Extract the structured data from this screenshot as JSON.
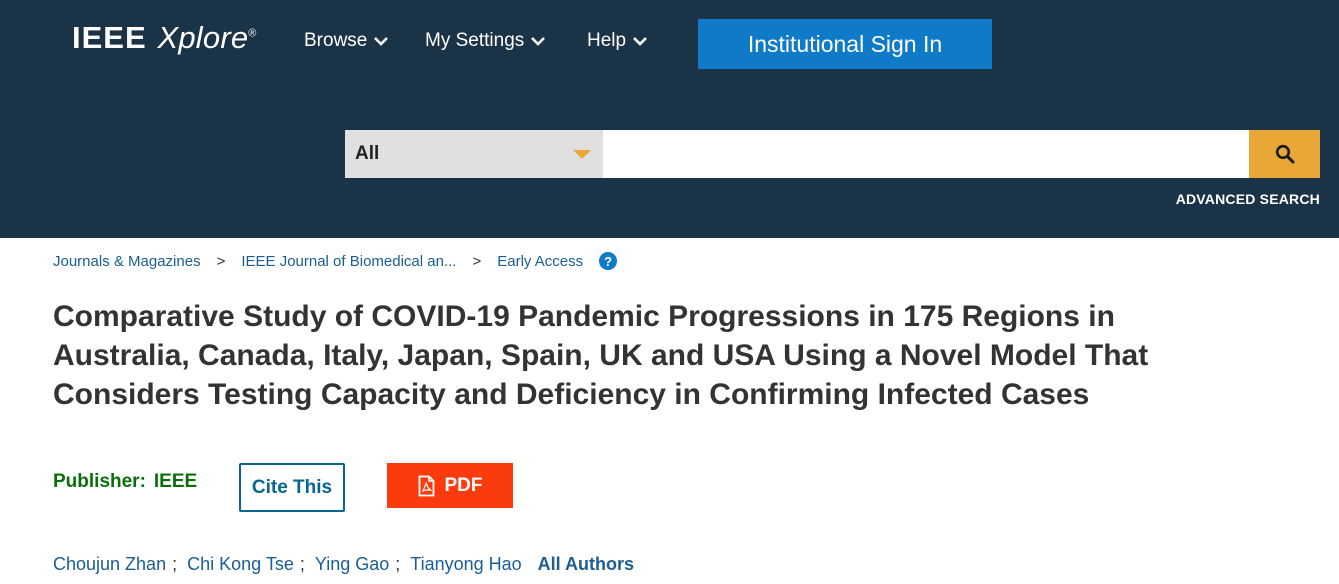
{
  "header": {
    "logo_main": "IEEE",
    "logo_sub": "Xplore",
    "logo_mark": "®",
    "nav": [
      {
        "label": "Browse"
      },
      {
        "label": "My Settings"
      },
      {
        "label": "Help"
      }
    ],
    "signin_label": "Institutional Sign In"
  },
  "search": {
    "scope_value": "All",
    "query_value": "",
    "search_icon": "search-icon",
    "advanced_label": "ADVANCED SEARCH"
  },
  "breadcrumb": {
    "items": [
      "Journals & Magazines",
      "IEEE Journal of Biomedical an...",
      "Early Access"
    ],
    "separator": ">",
    "help_glyph": "?"
  },
  "article": {
    "title": "Comparative Study of COVID-19 Pandemic Progressions in 175 Regions in Australia, Canada, Italy, Japan, Spain, UK and USA Using a Novel Model That Considers Testing Capacity and Deficiency in Confirming Infected Cases",
    "publisher_label": "Publisher:",
    "publisher_value": "IEEE",
    "cite_label": "Cite This",
    "pdf_label": "PDF",
    "authors": [
      "Choujun Zhan",
      "Chi Kong Tse",
      "Ying Gao",
      "Tianyong Hao"
    ],
    "author_separator": ";",
    "all_authors_label": "All Authors"
  },
  "colors": {
    "header_bg": "#1b3347",
    "signin_bg": "#0f7ac7",
    "search_accent": "#e8a736",
    "link": "#1a5e93",
    "publisher": "#0b6e0b",
    "pdf_bg": "#fa3b0d"
  }
}
